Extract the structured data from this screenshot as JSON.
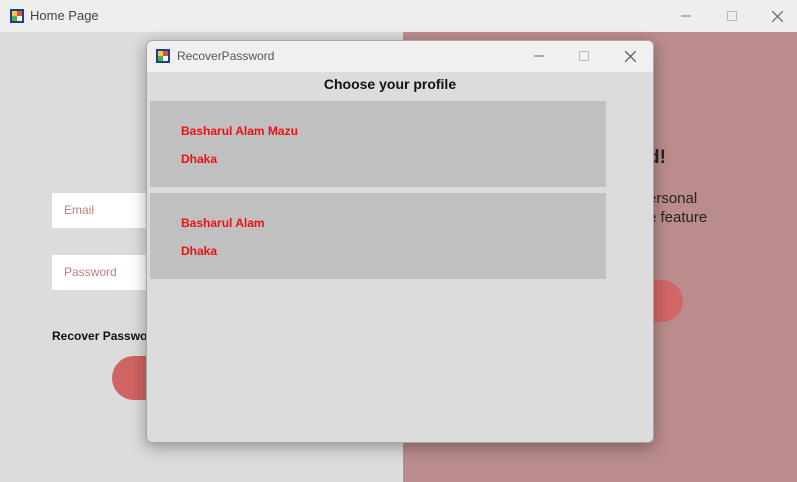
{
  "main_window": {
    "title": "Home Page",
    "email_placeholder": "Email",
    "password_placeholder": "Password",
    "recover_link": "Recover Passwo",
    "right_text_1": "d!",
    "right_text_2": "ersonal",
    "right_text_3": "e feature"
  },
  "dialog": {
    "title": "RecoverPassword",
    "heading": "Choose your profile",
    "profiles": [
      {
        "name": "Basharul Alam Mazu",
        "city": "Dhaka"
      },
      {
        "name": "Basharul Alam",
        "city": "Dhaka"
      }
    ]
  },
  "icons": {
    "app": "winforms-app-icon",
    "minimize": "minimize-icon",
    "maximize": "maximize-icon",
    "close": "close-icon"
  },
  "colors": {
    "accent_red": "#ee1111",
    "right_panel": "#bb8c8c",
    "button_red": "#d06464",
    "card_bg": "#c0c0c0"
  }
}
